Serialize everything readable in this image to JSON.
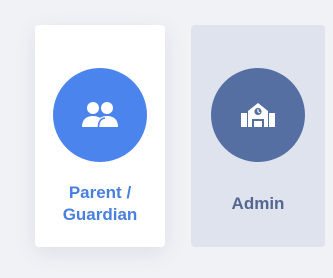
{
  "roles": [
    {
      "id": "parent",
      "label": "Parent /\nGuardian",
      "icon": "users-icon",
      "selected": true,
      "circle_color": "#4b84ec",
      "label_color": "#4a7fe0",
      "card_color": "#ffffff"
    },
    {
      "id": "admin",
      "label": "Admin",
      "icon": "school-building-icon",
      "selected": false,
      "circle_color": "#566fa3",
      "label_color": "#55678f",
      "card_color": "#dfe3ee"
    }
  ]
}
